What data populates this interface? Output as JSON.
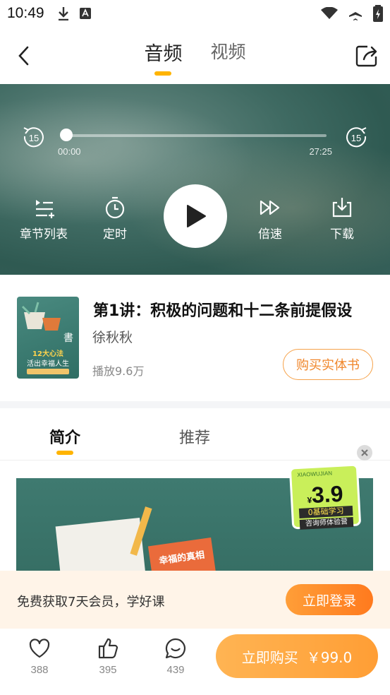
{
  "status_bar": {
    "time": "10:49"
  },
  "header": {
    "tabs": [
      {
        "label": "音频",
        "active": true
      },
      {
        "label": "视频",
        "active": false
      }
    ]
  },
  "player": {
    "skip_back_label": "15",
    "skip_forward_label": "15",
    "current_time": "00:00",
    "total_time": "27:25",
    "progress": 0,
    "controls": {
      "chapters": "章节列表",
      "timer": "定时",
      "speed": "倍速",
      "download": "下载"
    }
  },
  "book": {
    "cover": {
      "line1": "12大心法",
      "line2": "活出幸福人生",
      "char": "書"
    },
    "title": "第1讲：积极的问题和十二条前提假设",
    "author": "徐秋秋",
    "plays": "播放9.6万",
    "buy_physical": "购买实体书"
  },
  "intro_tabs": [
    {
      "label": "简介",
      "active": true
    },
    {
      "label": "推荐",
      "active": false
    }
  ],
  "banner": {
    "sign_text": "幸福的真相"
  },
  "promo": {
    "brand": "XIAOWUJIAN",
    "price": "3.9",
    "currency": "¥",
    "title": "0基础学习",
    "subtitle": "咨询师体验营"
  },
  "member_bar": {
    "text": "免费获取7天会员，学好课",
    "login_label": "立即登录"
  },
  "bottom_bar": {
    "likes": "388",
    "thumbs": "395",
    "comments": "439",
    "buy_label": "立即购买",
    "price": "￥99.0"
  },
  "colors": {
    "accent": "#ffb400",
    "orange": "#ff9e35",
    "player_bg": "#3f6a62"
  }
}
